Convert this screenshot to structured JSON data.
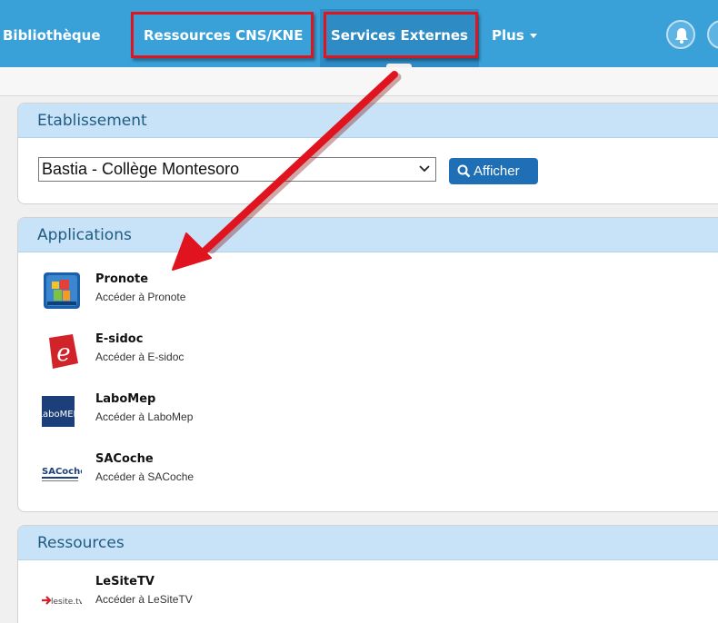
{
  "nav": {
    "items": [
      {
        "label": "Bibliothèque"
      },
      {
        "label": "Ressources CNS/KNE"
      },
      {
        "label": "Services Externes"
      },
      {
        "label": "Plus"
      }
    ]
  },
  "establishment": {
    "header": "Etablissement",
    "selected": "Bastia - Collège Montesoro",
    "button_label": "Afficher"
  },
  "applications": {
    "header": "Applications",
    "items": [
      {
        "title": "Pronote",
        "subtitle": "Accéder à Pronote",
        "icon": "pronote-logo"
      },
      {
        "title": "E-sidoc",
        "subtitle": "Accéder à E-sidoc",
        "icon": "esidoc-logo"
      },
      {
        "title": "LaboMep",
        "subtitle": "Accéder à LaboMep",
        "icon": "labomep-logo"
      },
      {
        "title": "SACoche",
        "subtitle": "Accéder à SACoche",
        "icon": "sacoche-logo"
      }
    ]
  },
  "resources": {
    "header": "Ressources",
    "items": [
      {
        "title": "LeSiteTV",
        "subtitle": "Accéder à LeSiteTV",
        "icon": "lesitetv-logo"
      }
    ]
  },
  "logos": {
    "labomep_text": "LaboMEP",
    "sacoche_text": "SACoche",
    "lesitetv_text": "lesite.tv",
    "esidoc_letter": "e"
  },
  "colors": {
    "nav_bg": "#3aa0d8",
    "highlight": "#e0141e",
    "panel_header": "#c8e2f7",
    "button": "#1e6fb5"
  }
}
